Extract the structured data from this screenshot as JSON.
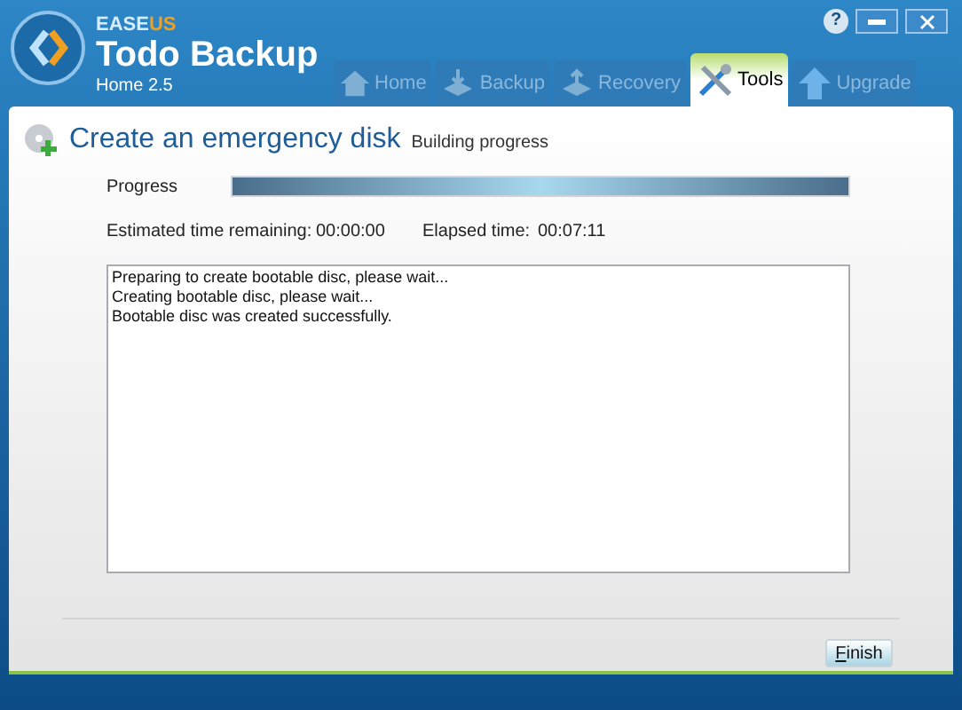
{
  "brand": {
    "maker": "EASE",
    "maker_accent": "US",
    "product": "Todo Backup",
    "edition": "Home 2.5"
  },
  "window_buttons": [
    {
      "kind": "help",
      "label": "?"
    },
    {
      "kind": "minimize"
    },
    {
      "kind": "close"
    }
  ],
  "tabs": [
    {
      "label": "Home",
      "kind": "home",
      "selected": false
    },
    {
      "label": "Backup",
      "kind": "backup",
      "selected": false
    },
    {
      "label": "Recovery",
      "kind": "recovery",
      "selected": false
    },
    {
      "label": "Tools",
      "kind": "tools",
      "selected": true
    },
    {
      "label": "Upgrade",
      "kind": "upgrade",
      "selected": false
    }
  ],
  "page": {
    "title": "Create an emergency disk",
    "subtitle": "Building progress"
  },
  "progress": {
    "label": "Progress",
    "level": 1
  },
  "times": {
    "remaining_label": "Estimated time remaining:",
    "remaining": "00:00:00",
    "elapsed_label": "Elapsed time:",
    "elapsed": "00:07:11"
  },
  "log": [
    "Preparing to create bootable disc, please wait...",
    "Creating bootable disc, please wait...",
    "Bootable disc was created successfully."
  ],
  "buttons": [
    "Finish"
  ]
}
